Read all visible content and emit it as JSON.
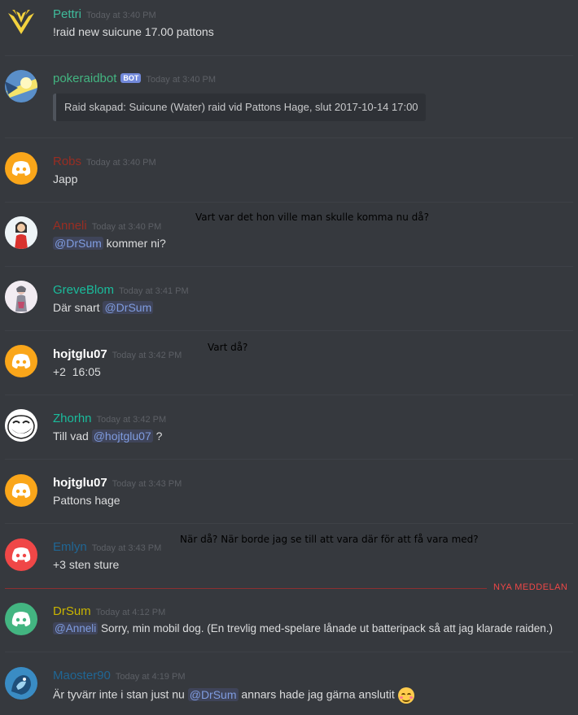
{
  "colors": {
    "background": "#36393e",
    "mention_bg": "#3f4459",
    "mention_fg": "#7f9ce0",
    "new_messages": "#f04747",
    "discord_orange": "#faa61a",
    "discord_red": "#f04747",
    "discord_green": "#43b581",
    "bot_tag": "#7289da"
  },
  "messages": [
    {
      "author": "Pettri",
      "author_color": "#3fbb9b",
      "time": "Today at 3:40 PM",
      "text": "!raid new suicune 17.00 pattons",
      "avatar": "team-instinct-icon"
    },
    {
      "author": "pokeraidbot",
      "author_color": "#43b581",
      "bot_tag": "BOT",
      "time": "Today at 3:40 PM",
      "embed": "Raid skapad: Suicune (Water) raid vid Pattons Hage, slut 2017-10-14 17:00",
      "avatar": "pokeraidbot-avatar"
    },
    {
      "author": "Robs",
      "author_color": "#992d22",
      "time": "Today at 3:40 PM",
      "text": "Japp",
      "avatar": "discord-logo-orange-icon"
    },
    {
      "author": "Anneli",
      "author_color": "#992d22",
      "time": "Today at 3:40 PM",
      "mention": "@DrSum",
      "text_after": " kommer ni?",
      "annotation": "Vart var det hon ville man skulle komma nu då?",
      "avatar": "anneli-avatar"
    },
    {
      "author": "GreveBlom",
      "author_color": "#1abc9c",
      "time": "Today at 3:41 PM",
      "text_before": "Där snart ",
      "mention": "@DrSum",
      "avatar": "greveblom-avatar"
    },
    {
      "author": "hojtglu07",
      "author_color": "#ffffff",
      "time": "Today at 3:42 PM",
      "text": "+2  16:05",
      "annotation": "Vart då?",
      "avatar": "discord-logo-orange-icon"
    },
    {
      "author": "Zhorhn",
      "author_color": "#1abc9c",
      "time": "Today at 3:42 PM",
      "text_before": "Till vad ",
      "mention": "@hojtglu07",
      "text_after": " ?",
      "avatar": "trollface-avatar"
    },
    {
      "author": "hojtglu07",
      "author_color": "#ffffff",
      "time": "Today at 3:43 PM",
      "text": "Pattons hage",
      "avatar": "discord-logo-orange-icon"
    },
    {
      "author": "Emlyn",
      "author_color": "#206694",
      "time": "Today at 3:43 PM",
      "text": "+3 sten sture",
      "annotation": "När då? När borde jag se till att vara där för att få vara med?",
      "avatar": "discord-logo-red-icon"
    },
    {
      "author": "DrSum",
      "author_color": "#c9b400",
      "time": "Today at 4:12 PM",
      "mention": "@Anneli",
      "text_after": " Sorry, min mobil dog. (En trevlig med-spelare lånade ut batteripack så att jag klarade raiden.)",
      "avatar": "discord-logo-green-icon"
    },
    {
      "author": "Maoster90",
      "author_color": "#206694",
      "time": "Today at 4:19 PM",
      "text_before": "Är tyvärr inte i stan just nu ",
      "mention": "@DrSum",
      "text_after": " annars hade jag gärna anslutit",
      "emoji": "smiling-face-emoji",
      "avatar": "maoster90-avatar"
    }
  ],
  "new_messages_label": "NYA MEDDELAN"
}
